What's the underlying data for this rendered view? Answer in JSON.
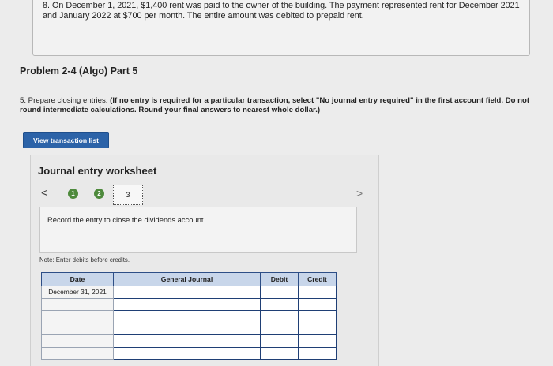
{
  "top_question": {
    "text": "8. On December 1, 2021, $1,400 rent was paid to the owner of the building. The payment represented rent for December 2021 and January 2022 at $700 per month. The entire amount was debited to prepaid rent."
  },
  "problem": {
    "title": "Problem 2-4 (Algo) Part 5",
    "instruction_plain": "5. Prepare closing entries. ",
    "instruction_bold": "(If no entry is required for a particular transaction, select \"No journal entry required\" in the first account field. Do not round intermediate calculations. Round your final answers to nearest whole dollar.)"
  },
  "buttons": {
    "view_transaction_list": "View transaction list"
  },
  "worksheet": {
    "title": "Journal entry worksheet",
    "prev_glyph": "<",
    "next_glyph": ">",
    "steps": [
      "1",
      "2",
      "3"
    ],
    "current_step": "3",
    "entry_instruction": "Record the entry to close the dividends account.",
    "note": "Note: Enter debits before credits."
  },
  "journal_table": {
    "headers": {
      "date": "Date",
      "general_journal": "General Journal",
      "debit": "Debit",
      "credit": "Credit"
    },
    "rows": [
      {
        "date": "December 31, 2021",
        "account": "",
        "debit": "",
        "credit": ""
      },
      {
        "date": "",
        "account": "",
        "debit": "",
        "credit": ""
      },
      {
        "date": "",
        "account": "",
        "debit": "",
        "credit": ""
      },
      {
        "date": "",
        "account": "",
        "debit": "",
        "credit": ""
      },
      {
        "date": "",
        "account": "",
        "debit": "",
        "credit": ""
      },
      {
        "date": "",
        "account": "",
        "debit": "",
        "credit": ""
      }
    ]
  },
  "colors": {
    "button_blue": "#2c63a8",
    "step_green": "#4e8a3c",
    "table_header_bg": "#c8d6ea",
    "table_border_dark": "#1f3f75"
  }
}
